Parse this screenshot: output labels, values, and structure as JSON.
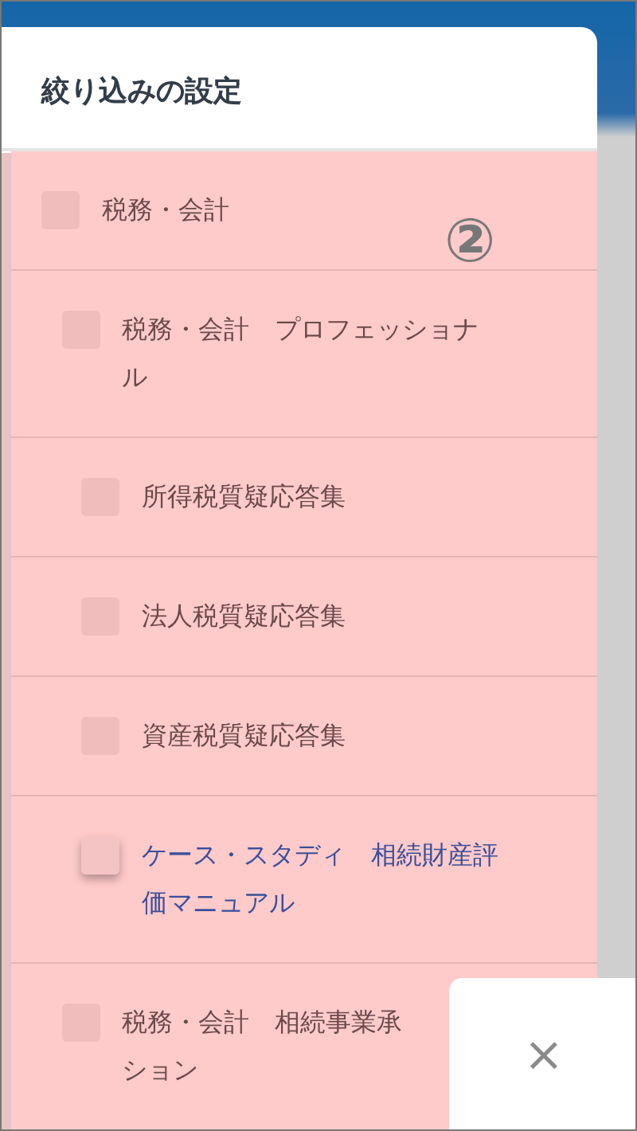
{
  "panel": {
    "title": "絞り込みの設定"
  },
  "annotation": "②",
  "filters": [
    {
      "label": "税務・会計",
      "checked": false,
      "hovered": false,
      "children": [
        {
          "label": "税務・会計　プロフェッショナル",
          "checked": false,
          "hovered": false,
          "children": [
            {
              "label": "所得税質疑応答集",
              "checked": false,
              "hovered": false
            },
            {
              "label": "法人税質疑応答集",
              "checked": false,
              "hovered": false
            },
            {
              "label": "資産税質疑応答集",
              "checked": false,
              "hovered": false
            },
            {
              "label": "ケース・スタディ　相続財産評価マニュアル",
              "checked": false,
              "hovered": true
            }
          ]
        },
        {
          "label": "税務・会計　相続事業承",
          "continuation": "ション",
          "checked": false,
          "hovered": false
        }
      ]
    }
  ],
  "close_button": {
    "label": "×"
  }
}
